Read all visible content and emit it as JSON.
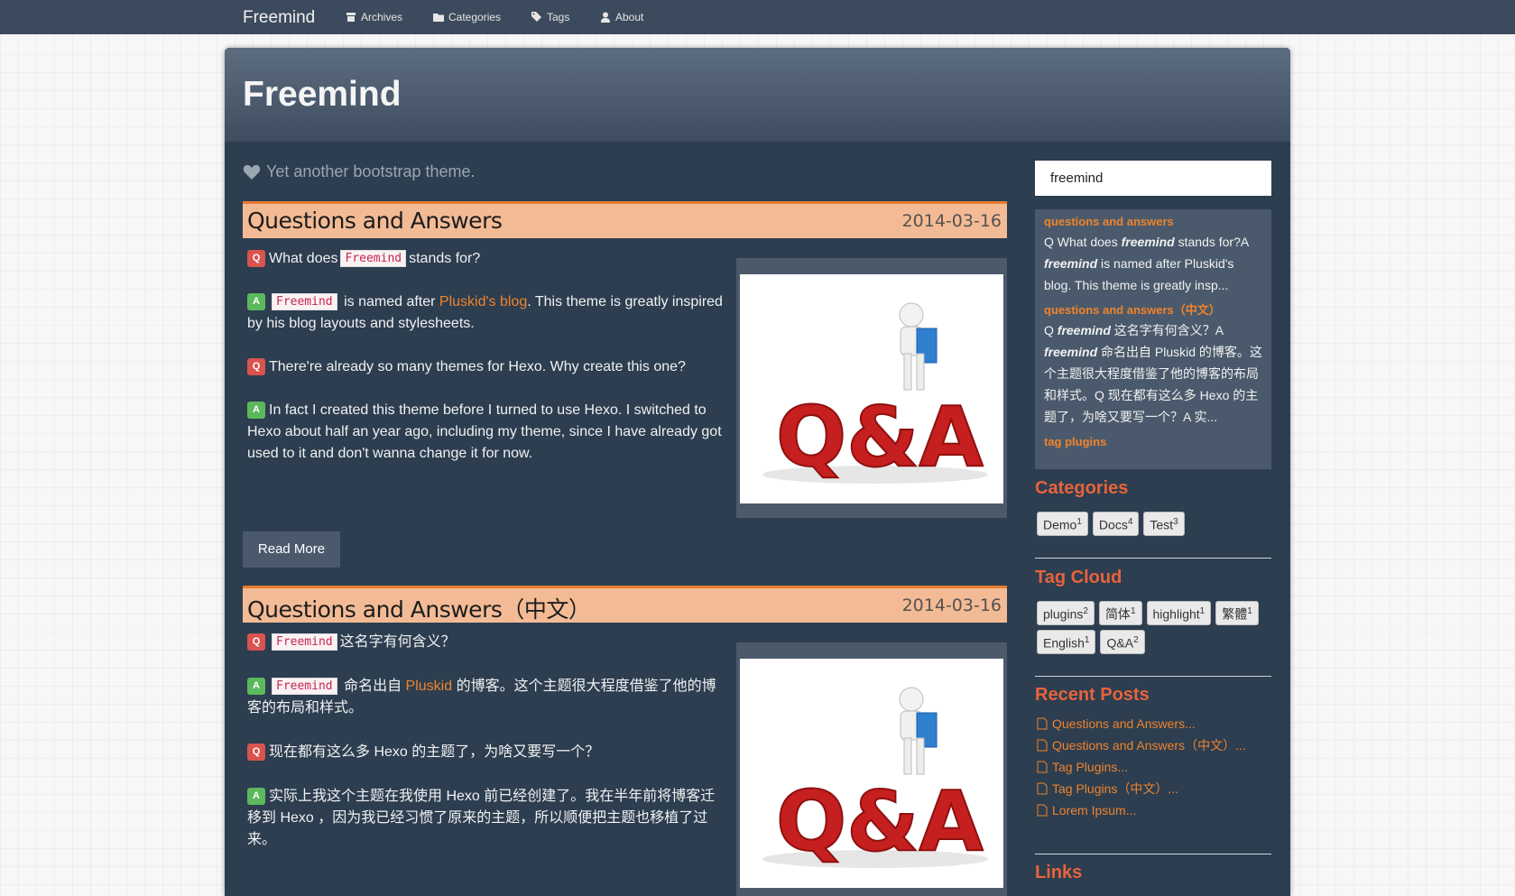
{
  "nav": {
    "brand": "Freemind",
    "items": [
      {
        "label": "Archives",
        "icon": "archive-icon"
      },
      {
        "label": "Categories",
        "icon": "folder-icon"
      },
      {
        "label": "Tags",
        "icon": "tags-icon"
      },
      {
        "label": "About",
        "icon": "user-icon"
      }
    ]
  },
  "site": {
    "title": "Freemind",
    "tagline": "Yet another bootstrap theme."
  },
  "posts": [
    {
      "title": "Questions and Answers",
      "date": "2014-03-16",
      "q1_pre": "What does",
      "q1_code": "Freemind",
      "q1_post": "stands for?",
      "a1_code": "Freemind",
      "a1_pre": "is named after",
      "a1_link": "Pluskid's blog",
      "a1_post": ". This theme is greatly inspired by his blog layouts and stylesheets.",
      "q2": "There're already so many themes for Hexo. Why create this one?",
      "a2": "In fact I created this theme before I turned to use Hexo. I switched to Hexo about half an year ago, including my theme, since I have already got used to it and don't wanna change it for now.",
      "read_more": "Read More"
    },
    {
      "title": "Questions and Answers（中文）",
      "date": "2014-03-16",
      "q1_code": "Freemind",
      "q1_post": "这名字有何含义？",
      "a1_code": "Freemind",
      "a1_pre": "命名出自",
      "a1_link": "Pluskid",
      "a1_post": "的博客。这个主题很大程度借鉴了他的博客的布局和样式。",
      "q2": "现在都有这么多 Hexo 的主题了，为啥又要写一个？",
      "a2": "实际上我这个主题在我使用 Hexo 前已经创建了。我在半年前将博客迁移到 Hexo ，因为我已经习惯了原来的主题，所以顺便把主题也移植了过来。"
    }
  ],
  "badges": {
    "q": "Q",
    "a": "A"
  },
  "search": {
    "value": "freemind",
    "results": [
      {
        "title": "questions and answers",
        "body_pre": "Q What does ",
        "em": "freemind",
        "body_mid": " stands for?A ",
        "em2": "freemind",
        "body_post": " is named after Pluskid's blog. This theme is greatly insp..."
      },
      {
        "title": "questions and answers（中文）",
        "body_pre": "Q ",
        "em": "freemind",
        "body_mid": " 这名字有何含义？A ",
        "em2": "freemind",
        "body_post": " 命名出自 Pluskid 的博客。这个主题很大程度借鉴了他的博客的布局和样式。Q 现在都有这么多 Hexo 的主题了，为啥又要写一个？A 实..."
      },
      {
        "title": "tag plugins"
      }
    ]
  },
  "sidebar": {
    "categories_heading": "Categories",
    "categories": [
      {
        "name": "Demo",
        "count": "1"
      },
      {
        "name": "Docs",
        "count": "4"
      },
      {
        "name": "Test",
        "count": "3"
      }
    ],
    "tagcloud_heading": "Tag Cloud",
    "tags_row1": [
      {
        "name": "plugins",
        "count": "2"
      },
      {
        "name": "简体",
        "count": "1"
      },
      {
        "name": "highlight",
        "count": "1"
      },
      {
        "name": "繁體",
        "count": "1"
      }
    ],
    "tags_row2": [
      {
        "name": "English",
        "count": "1"
      },
      {
        "name": "Q&A",
        "count": "2"
      }
    ],
    "recent_heading": "Recent Posts",
    "recent": [
      "Questions and Answers...",
      "Questions and Answers（中文）...",
      "Tag Plugins...",
      "Tag Plugins（中文）...",
      "Lorem Ipsum..."
    ],
    "links_heading": "Links"
  },
  "image": {
    "caption": "Q&A"
  }
}
